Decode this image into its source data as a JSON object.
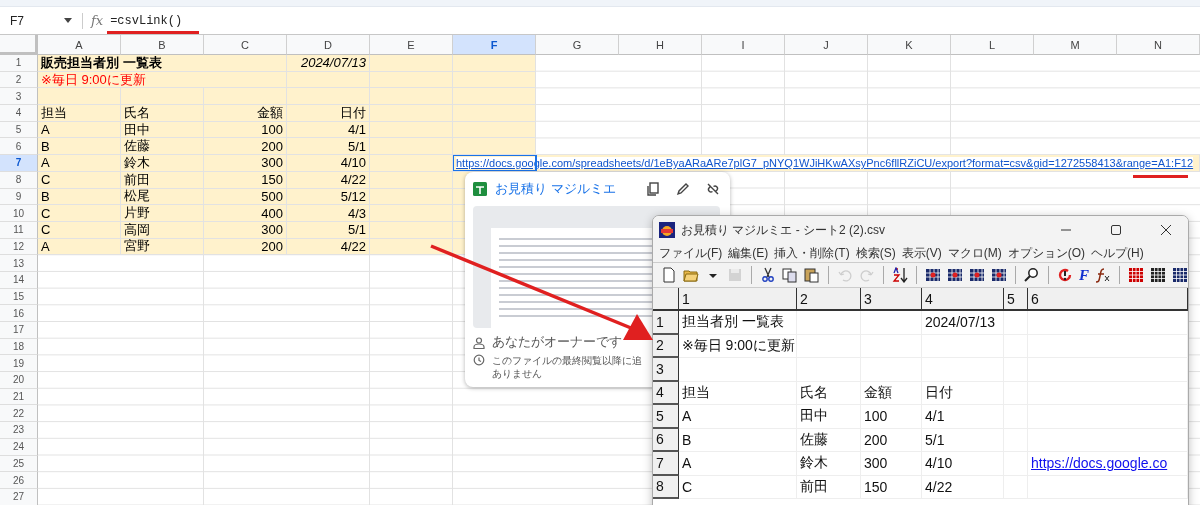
{
  "formula_bar": {
    "cell_ref": "F7",
    "fx": "fx",
    "formula": "=csvLink()"
  },
  "sheet": {
    "columns": [
      {
        "label": "A",
        "selected": false
      },
      {
        "label": "B",
        "selected": false
      },
      {
        "label": "C",
        "selected": false
      },
      {
        "label": "D",
        "selected": false
      },
      {
        "label": "E",
        "selected": false
      },
      {
        "label": "F",
        "selected": true
      },
      {
        "label": "G",
        "selected": false
      },
      {
        "label": "H",
        "selected": false
      },
      {
        "label": "I",
        "selected": false
      },
      {
        "label": "J",
        "selected": false
      },
      {
        "label": "K",
        "selected": false
      },
      {
        "label": "L",
        "selected": false
      },
      {
        "label": "M",
        "selected": false
      },
      {
        "label": "N",
        "selected": false
      }
    ],
    "rows": [
      {
        "label": "1",
        "selected": false,
        "filled": true,
        "cells": [
          {
            "text": "販売担当者別 一覧表",
            "kind": "title"
          },
          null,
          null,
          {
            "text": "2024/07/13",
            "kind": "date"
          }
        ]
      },
      {
        "label": "2",
        "selected": false,
        "filled": true,
        "cells": [
          {
            "text": "※毎日 9:00に更新",
            "kind": "note"
          }
        ]
      },
      {
        "label": "3",
        "selected": false,
        "filled": true
      },
      {
        "label": "4",
        "selected": false,
        "filled": true,
        "cells": [
          {
            "text": "担当",
            "kind": "text"
          },
          {
            "text": "氏名",
            "kind": "text"
          },
          {
            "text": "金額",
            "kind": "text"
          },
          {
            "text": "日付",
            "kind": "text"
          }
        ]
      },
      {
        "label": "5",
        "selected": false,
        "filled": true,
        "cells": [
          {
            "text": "A",
            "kind": "text"
          },
          {
            "text": "田中",
            "kind": "text"
          },
          {
            "text": "100",
            "kind": "number"
          },
          {
            "text": "4/1",
            "kind": "number"
          }
        ]
      },
      {
        "label": "6",
        "selected": false,
        "filled": true,
        "cells": [
          {
            "text": "B",
            "kind": "text"
          },
          {
            "text": "佐藤",
            "kind": "text"
          },
          {
            "text": "200",
            "kind": "number"
          },
          {
            "text": "5/1",
            "kind": "number"
          }
        ]
      },
      {
        "label": "7",
        "selected": true,
        "filled": true,
        "cells": [
          {
            "text": "A",
            "kind": "text"
          },
          {
            "text": "鈴木",
            "kind": "text"
          },
          {
            "text": "300",
            "kind": "number"
          },
          {
            "text": "4/10",
            "kind": "number"
          },
          null,
          {
            "text": "https://docs.google.com/spreadsheets/d/1eByaARaARe7plG7_pNYQ1WJiHKwAXsyPnc6fllRZiCU/export?format=csv&gid=1272558413&range=A1:F12",
            "kind": "link"
          }
        ]
      },
      {
        "label": "8",
        "selected": false,
        "filled": true,
        "cells": [
          {
            "text": "C",
            "kind": "text"
          },
          {
            "text": "前田",
            "kind": "text"
          },
          {
            "text": "150",
            "kind": "number"
          },
          {
            "text": "4/22",
            "kind": "number"
          }
        ]
      },
      {
        "label": "9",
        "selected": false,
        "filled": true,
        "cells": [
          {
            "text": "B",
            "kind": "text"
          },
          {
            "text": "松尾",
            "kind": "text"
          },
          {
            "text": "500",
            "kind": "number"
          },
          {
            "text": "5/12",
            "kind": "number"
          }
        ]
      },
      {
        "label": "10",
        "selected": false,
        "filled": true,
        "cells": [
          {
            "text": "C",
            "kind": "text"
          },
          {
            "text": "片野",
            "kind": "text"
          },
          {
            "text": "400",
            "kind": "number"
          },
          {
            "text": "4/3",
            "kind": "number"
          }
        ]
      },
      {
        "label": "11",
        "selected": false,
        "filled": true,
        "cells": [
          {
            "text": "C",
            "kind": "text"
          },
          {
            "text": "高岡",
            "kind": "text"
          },
          {
            "text": "300",
            "kind": "number"
          },
          {
            "text": "5/1",
            "kind": "number"
          }
        ]
      },
      {
        "label": "12",
        "selected": false,
        "filled": true,
        "cells": [
          {
            "text": "A",
            "kind": "text"
          },
          {
            "text": "宮野",
            "kind": "text"
          },
          {
            "text": "200",
            "kind": "number"
          },
          {
            "text": "4/22",
            "kind": "number"
          }
        ]
      },
      {
        "label": "13",
        "selected": false,
        "filled": false
      },
      {
        "label": "14",
        "selected": false,
        "filled": false
      },
      {
        "label": "15",
        "selected": false,
        "filled": false
      },
      {
        "label": "16",
        "selected": false,
        "filled": false
      },
      {
        "label": "17",
        "selected": false,
        "filled": false
      },
      {
        "label": "18",
        "selected": false,
        "filled": false
      },
      {
        "label": "19",
        "selected": false,
        "filled": false
      },
      {
        "label": "20",
        "selected": false,
        "filled": false
      },
      {
        "label": "21",
        "selected": false,
        "filled": false
      },
      {
        "label": "22",
        "selected": false,
        "filled": false
      },
      {
        "label": "23",
        "selected": false,
        "filled": false
      },
      {
        "label": "24",
        "selected": false,
        "filled": false
      },
      {
        "label": "25",
        "selected": false,
        "filled": false
      },
      {
        "label": "26",
        "selected": false,
        "filled": false
      },
      {
        "label": "27",
        "selected": false,
        "filled": false
      }
    ]
  },
  "link_card": {
    "title": "お見積り マジルミエ",
    "owner_text": "あなたがオーナーです",
    "activity_lines": [
      "このファイルの最終閲覧以降に追",
      "ありません"
    ]
  },
  "csv_window": {
    "title": "お見積り マジルミエ - シート2 (2).csv",
    "menu": [
      "ファイル(F)",
      "編集(E)",
      "挿入・削除(T)",
      "検索(S)",
      "表示(V)",
      "マクロ(M)",
      "オプション(O)",
      "ヘルプ(H)"
    ],
    "toolbar": [
      {
        "kind": "new",
        "disabled": false
      },
      {
        "kind": "open",
        "disabled": false
      },
      {
        "kind": "dropdown",
        "disabled": false
      },
      {
        "kind": "save",
        "disabled": true
      },
      {
        "kind": "separator"
      },
      {
        "kind": "cut",
        "disabled": false
      },
      {
        "kind": "copy",
        "disabled": false
      },
      {
        "kind": "paste",
        "disabled": false
      },
      {
        "kind": "separator"
      },
      {
        "kind": "undo",
        "disabled": true
      },
      {
        "kind": "redo",
        "disabled": true
      },
      {
        "kind": "separator"
      },
      {
        "kind": "sort",
        "disabled": false
      },
      {
        "kind": "separator"
      },
      {
        "kind": "grid",
        "disabled": false
      },
      {
        "kind": "grid",
        "disabled": false
      },
      {
        "kind": "grid",
        "disabled": false
      },
      {
        "kind": "grid",
        "disabled": false
      },
      {
        "kind": "separator"
      },
      {
        "kind": "find",
        "disabled": false
      },
      {
        "kind": "separator"
      },
      {
        "kind": "refresh",
        "disabled": false
      },
      {
        "kind": "font",
        "label": "F",
        "disabled": false
      },
      {
        "kind": "function",
        "disabled": false
      },
      {
        "kind": "separator"
      },
      {
        "kind": "table",
        "color": "#cc0000",
        "disabled": false
      },
      {
        "kind": "table",
        "color": "#222222",
        "disabled": false
      },
      {
        "kind": "table",
        "color": "#1a2a6a",
        "disabled": false
      }
    ],
    "columns": [
      "1",
      "2",
      "3",
      "4",
      "5",
      "6"
    ],
    "rows": [
      {
        "label": "1",
        "cells": [
          {
            "text": "担当者別 一覧表",
            "kind": "text"
          },
          null,
          null,
          {
            "text": "2024/07/13",
            "kind": "text"
          }
        ]
      },
      {
        "label": "2",
        "cells": [
          {
            "text": "※毎日 9:00に更新",
            "kind": "text"
          }
        ]
      },
      {
        "label": "3"
      },
      {
        "label": "4",
        "cells": [
          {
            "text": "担当",
            "kind": "text"
          },
          {
            "text": "氏名",
            "kind": "text"
          },
          {
            "text": "金額",
            "kind": "text"
          },
          {
            "text": "日付",
            "kind": "text"
          }
        ]
      },
      {
        "label": "5",
        "cells": [
          {
            "text": "A",
            "kind": "text"
          },
          {
            "text": "田中",
            "kind": "text"
          },
          {
            "text": "100",
            "kind": "text"
          },
          {
            "text": "4/1",
            "kind": "text"
          }
        ]
      },
      {
        "label": "6",
        "cells": [
          {
            "text": "B",
            "kind": "text"
          },
          {
            "text": "佐藤",
            "kind": "text"
          },
          {
            "text": "200",
            "kind": "text"
          },
          {
            "text": "5/1",
            "kind": "text"
          }
        ]
      },
      {
        "label": "7",
        "cells": [
          {
            "text": "A",
            "kind": "text"
          },
          {
            "text": "鈴木",
            "kind": "text"
          },
          {
            "text": "300",
            "kind": "text"
          },
          {
            "text": "4/10",
            "kind": "text"
          },
          null,
          {
            "text": "https://docs.google.co",
            "kind": "link"
          }
        ]
      },
      {
        "label": "8",
        "cells": [
          {
            "text": "C",
            "kind": "text"
          },
          {
            "text": "前田",
            "kind": "text"
          },
          {
            "text": "150",
            "kind": "text"
          },
          {
            "text": "4/22",
            "kind": "text"
          }
        ]
      }
    ]
  }
}
